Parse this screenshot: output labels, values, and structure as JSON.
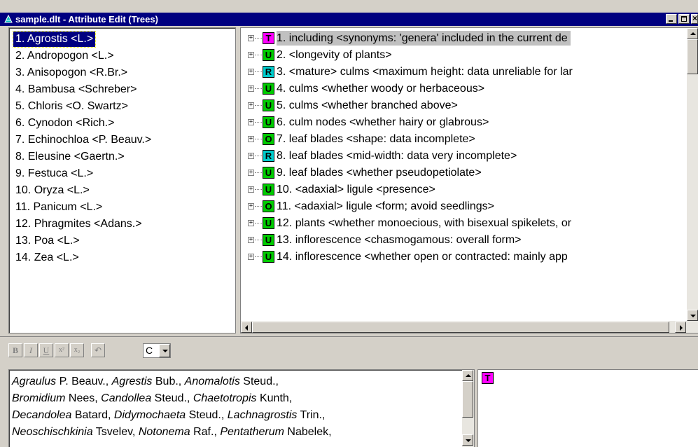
{
  "window": {
    "title": "sample.dlt - Attribute Edit (Trees)",
    "app_icon": "delta-icon",
    "controls": [
      "minimize",
      "maximize",
      "close"
    ]
  },
  "taxa": [
    {
      "label": "1. Agrostis <L.>",
      "selected": true
    },
    {
      "label": "2. Andropogon <L.>"
    },
    {
      "label": "3. Anisopogon <R.Br.>"
    },
    {
      "label": "4. Bambusa <Schreber>"
    },
    {
      "label": "5. Chloris <O. Swartz>"
    },
    {
      "label": "6. Cynodon <Rich.>"
    },
    {
      "label": "7. Echinochloa <P. Beauv.>"
    },
    {
      "label": "8. Eleusine <Gaertn.>"
    },
    {
      "label": "9. Festuca <L.>"
    },
    {
      "label": "10. Oryza <L.>"
    },
    {
      "label": "11. Panicum <L.>"
    },
    {
      "label": "12. Phragmites <Adans.>"
    },
    {
      "label": "13. Poa <L.>"
    },
    {
      "label": "14. Zea <L.>"
    }
  ],
  "attributes": [
    {
      "code": "T",
      "text": "1. including <synonyms: 'genera' included in the current de",
      "selected": true
    },
    {
      "code": "U",
      "text": "2. <longevity of plants>"
    },
    {
      "code": "R",
      "text": "3. <mature> culms <maximum height: data unreliable for lar"
    },
    {
      "code": "U",
      "text": "4. culms <whether woody or herbaceous>"
    },
    {
      "code": "U",
      "text": "5. culms <whether branched above>"
    },
    {
      "code": "U",
      "text": "6. culm nodes <whether hairy or glabrous>"
    },
    {
      "code": "O",
      "text": "7. leaf blades <shape: data incomplete>"
    },
    {
      "code": "R",
      "text": "8. leaf blades <mid-width: data very incomplete>"
    },
    {
      "code": "U",
      "text": "9. leaf blades <whether pseudopetiolate>"
    },
    {
      "code": "U",
      "text": "10. <adaxial> ligule <presence>"
    },
    {
      "code": "O",
      "text": "11. <adaxial> ligule <form; avoid seedlings>"
    },
    {
      "code": "U",
      "text": "12. plants <whether monoecious, with bisexual spikelets, or"
    },
    {
      "code": "U",
      "text": "13. inflorescence <chasmogamous: overall form>"
    },
    {
      "code": "U",
      "text": "14. inflorescence <whether open or contracted: mainly app"
    }
  ],
  "badge_colors": {
    "T": "#ff00ff",
    "U": "#00cc00",
    "R": "#00cccc",
    "O": "#00cc00"
  },
  "toolbar": {
    "bold": "B",
    "italic": "I",
    "underline": "U",
    "superscript": "x²",
    "subscript": "x₂",
    "undo": "↶",
    "font_value": "C"
  },
  "editor": {
    "lines": [
      [
        {
          "t": "Agraulus",
          "i": true
        },
        {
          "t": " P. Beauv., "
        },
        {
          "t": "Agrestis",
          "i": true
        },
        {
          "t": " Bub., "
        },
        {
          "t": "Anomalotis",
          "i": true
        },
        {
          "t": " Steud.,"
        }
      ],
      [
        {
          "t": "Bromidium",
          "i": true
        },
        {
          "t": " Nees, "
        },
        {
          "t": "Candollea",
          "i": true
        },
        {
          "t": " Steud., "
        },
        {
          "t": "Chaetotropis",
          "i": true
        },
        {
          "t": " Kunth,"
        }
      ],
      [
        {
          "t": "Decandolea",
          "i": true
        },
        {
          "t": " Batard, "
        },
        {
          "t": "Didymochaeta",
          "i": true
        },
        {
          "t": " Steud., "
        },
        {
          "t": "Lachnagrostis",
          "i": true
        },
        {
          "t": " Trin.,"
        }
      ],
      [
        {
          "t": "Neoschischkinia",
          "i": true
        },
        {
          "t": " Tsvelev, "
        },
        {
          "t": "Notonema",
          "i": true
        },
        {
          "t": " Raf., "
        },
        {
          "t": "Pentatherum",
          "i": true
        },
        {
          "t": " Nabelek,"
        }
      ]
    ]
  },
  "preview": {
    "code": "T"
  }
}
